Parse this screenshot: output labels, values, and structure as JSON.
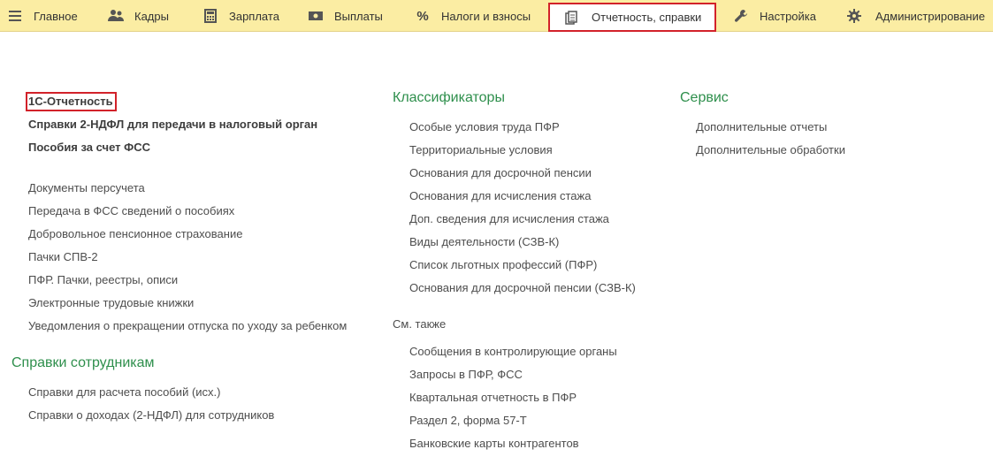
{
  "nav": {
    "items": [
      {
        "label": "Главное",
        "icon": "hamburger-icon"
      },
      {
        "label": "Кадры",
        "icon": "people-icon"
      },
      {
        "label": "Зарплата",
        "icon": "calculator-icon"
      },
      {
        "label": "Выплаты",
        "icon": "money-icon"
      },
      {
        "label": "Налоги и взносы",
        "icon": "percent-icon"
      },
      {
        "label": "Отчетность, справки",
        "icon": "documents-icon"
      },
      {
        "label": "Настройка",
        "icon": "wrench-icon"
      },
      {
        "label": "Администрирование",
        "icon": "gear-icon"
      }
    ],
    "active": "Отчетность, справки"
  },
  "left": {
    "bold_links": [
      "1С-Отчетность",
      "Справки 2-НДФЛ для передачи в налоговый орган",
      "Пособия за счет ФСС"
    ],
    "links": [
      "Документы персучета",
      "Передача в ФСС сведений о пособиях",
      "Добровольное пенсионное страхование",
      "Пачки СПВ-2",
      "ПФР. Пачки, реестры, описи",
      "Электронные трудовые книжки",
      "Уведомления о прекращении отпуска по уходу за ребенком"
    ],
    "employees_title": "Справки сотрудникам",
    "employees_links": [
      "Справки для расчета пособий (исх.)",
      "Справки о доходах (2-НДФЛ) для сотрудников"
    ]
  },
  "middle": {
    "title": "Классификаторы",
    "links": [
      "Особые условия труда ПФР",
      "Территориальные условия",
      "Основания для досрочной пенсии",
      "Основания для исчисления стажа",
      "Доп. сведения для исчисления стажа",
      "Виды деятельности (СЗВ-К)",
      "Список льготных профессий (ПФР)",
      "Основания для досрочной пенсии (СЗВ-К)"
    ],
    "see_also_title": "См. также",
    "see_also_links": [
      "Сообщения в контролирующие органы",
      "Запросы в ПФР, ФСС",
      "Квартальная отчетность в ПФР",
      "Раздел 2, форма 57-Т",
      "Банковские карты контрагентов"
    ]
  },
  "right": {
    "title": "Сервис",
    "links": [
      "Дополнительные отчеты",
      "Дополнительные обработки"
    ]
  },
  "colors": {
    "topbar": "#fbeda3",
    "section_title": "#2e8f4c",
    "highlight": "#d2222a"
  }
}
